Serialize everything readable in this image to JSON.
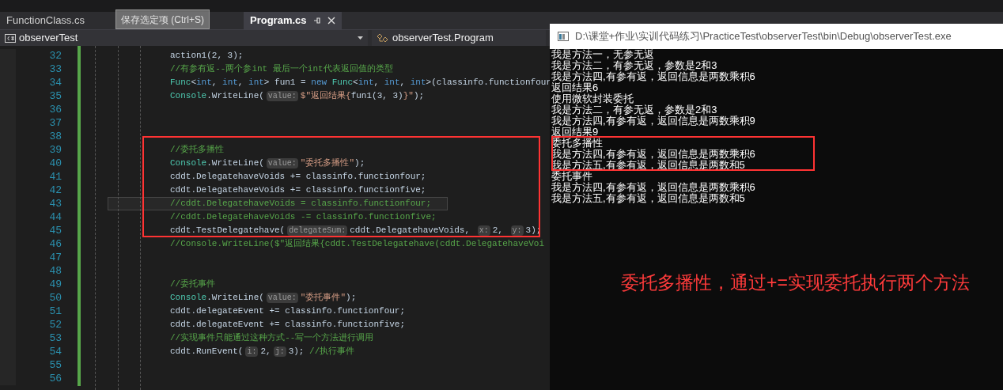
{
  "tabs": [
    {
      "label": "FunctionClass.cs",
      "selected": false
    },
    {
      "label": "Program.cs",
      "selected": true
    }
  ],
  "tooltip": "保存选定项 (Ctrl+S)",
  "navigation": {
    "project": "observerTest",
    "class": "observerTest.Program"
  },
  "code_lines": [
    {
      "number": "32",
      "current": false,
      "tokens": [
        {
          "kind": "code",
          "text": "action1(2, 3);"
        }
      ]
    },
    {
      "number": "33",
      "current": false,
      "tokens": [
        {
          "kind": "comment",
          "text": "//有参有返--两个参int 最后一个int代表返回值的类型"
        }
      ]
    },
    {
      "number": "34",
      "current": false,
      "tokens": [
        {
          "kind": "type",
          "text": "Func"
        },
        {
          "kind": "code",
          "text": "<"
        },
        {
          "kind": "keyword",
          "text": "int"
        },
        {
          "kind": "code",
          "text": ", "
        },
        {
          "kind": "keyword",
          "text": "int"
        },
        {
          "kind": "code",
          "text": ", "
        },
        {
          "kind": "keyword",
          "text": "int"
        },
        {
          "kind": "code",
          "text": "> fun1 = "
        },
        {
          "kind": "keyword",
          "text": "new"
        },
        {
          "kind": "type",
          "text": "Func",
          "spaced": true
        },
        {
          "kind": "code",
          "text": "<"
        },
        {
          "kind": "keyword",
          "text": "int"
        },
        {
          "kind": "code",
          "text": ", "
        },
        {
          "kind": "keyword",
          "text": "int"
        },
        {
          "kind": "code",
          "text": ", "
        },
        {
          "kind": "keyword",
          "text": "int"
        },
        {
          "kind": "code",
          "text": ">(classinfo.functionfour"
        }
      ]
    },
    {
      "number": "35",
      "current": false,
      "tokens": [
        {
          "kind": "type",
          "text": "Console"
        },
        {
          "kind": "code",
          "text": ".WriteLine("
        },
        {
          "kind": "hint",
          "text": "value:"
        },
        {
          "kind": "string",
          "text": "$\"返回结果{"
        },
        {
          "kind": "code",
          "text": "fun1(3, 3)"
        },
        {
          "kind": "string",
          "text": "}\""
        },
        {
          "kind": "code",
          "text": ");"
        }
      ]
    },
    {
      "number": "36",
      "current": false
    },
    {
      "number": "37",
      "current": false
    },
    {
      "number": "38",
      "current": false
    },
    {
      "number": "39",
      "current": false,
      "tokens": [
        {
          "kind": "comment",
          "text": "//委托多播性"
        }
      ]
    },
    {
      "number": "40",
      "current": false,
      "tokens": [
        {
          "kind": "type",
          "text": "Console"
        },
        {
          "kind": "code",
          "text": ".WriteLine("
        },
        {
          "kind": "hint",
          "text": "value:"
        },
        {
          "kind": "string",
          "text": "\"委托多播性\""
        },
        {
          "kind": "code",
          "text": ");"
        }
      ]
    },
    {
      "number": "41",
      "current": false,
      "tokens": [
        {
          "kind": "code",
          "text": "cddt.DelegatehaveVoids += classinfo.functionfour;"
        }
      ]
    },
    {
      "number": "42",
      "current": false,
      "tokens": [
        {
          "kind": "code",
          "text": "cddt.DelegatehaveVoids += classinfo.functionfive;"
        }
      ]
    },
    {
      "number": "43",
      "current": true,
      "tokens": [
        {
          "kind": "comment",
          "text": "//cddt.DelegatehaveVoids = classinfo.functionfour;"
        }
      ]
    },
    {
      "number": "44",
      "current": false,
      "tokens": [
        {
          "kind": "comment",
          "text": "//cddt.DelegatehaveVoids -= classinfo.functionfive;"
        }
      ]
    },
    {
      "number": "45",
      "current": false,
      "tokens": [
        {
          "kind": "code",
          "text": "cddt.TestDelegatehave("
        },
        {
          "kind": "hint",
          "text": "delegateSum:"
        },
        {
          "kind": "code",
          "text": "cddt.DelegatehaveVoids, "
        },
        {
          "kind": "hint",
          "text": "x:"
        },
        {
          "kind": "code",
          "text": "2, "
        },
        {
          "kind": "hint",
          "text": "y:"
        },
        {
          "kind": "code",
          "text": "3);"
        }
      ]
    },
    {
      "number": "46",
      "current": false,
      "tokens": [
        {
          "kind": "comment",
          "text": "//Console.WriteLine($\"返回结果{cddt.TestDelegatehave(cddt.DelegatehaveVoi"
        }
      ]
    },
    {
      "number": "47",
      "current": false
    },
    {
      "number": "48",
      "current": false
    },
    {
      "number": "49",
      "current": false,
      "tokens": [
        {
          "kind": "comment",
          "text": "//委托事件"
        }
      ]
    },
    {
      "number": "50",
      "current": false,
      "tokens": [
        {
          "kind": "type",
          "text": "Console"
        },
        {
          "kind": "code",
          "text": ".WriteLine("
        },
        {
          "kind": "hint",
          "text": "value:"
        },
        {
          "kind": "string",
          "text": "\"委托事件\""
        },
        {
          "kind": "code",
          "text": ");"
        }
      ]
    },
    {
      "number": "51",
      "current": false,
      "tokens": [
        {
          "kind": "code",
          "text": "cddt.delegateEvent += classinfo.functionfour;"
        }
      ]
    },
    {
      "number": "52",
      "current": false,
      "tokens": [
        {
          "kind": "code",
          "text": "cddt.delegateEvent += classinfo.functionfive;"
        }
      ]
    },
    {
      "number": "53",
      "current": false,
      "tokens": [
        {
          "kind": "comment",
          "text": "//实现事件只能通过这种方式--写一个方法进行调用"
        }
      ]
    },
    {
      "number": "54",
      "current": false,
      "tokens": [
        {
          "kind": "code",
          "text": "cddt.RunEvent("
        },
        {
          "kind": "hint",
          "text": "i:"
        },
        {
          "kind": "code",
          "text": "2,"
        },
        {
          "kind": "hint",
          "text": "j:"
        },
        {
          "kind": "code",
          "text": "3); "
        },
        {
          "kind": "comment",
          "text": "//执行事件"
        }
      ]
    },
    {
      "number": "55",
      "current": false
    },
    {
      "number": "56",
      "current": false
    }
  ],
  "console": {
    "title": "D:\\课堂+作业\\实训代码练习\\PracticeTest\\observerTest\\bin\\Debug\\observerTest.exe",
    "lines": [
      "我是方法一，无参无返",
      "我是方法二，有参无返，参数是2和3",
      "我是方法四,有参有返，返回信息是两数乘积6",
      "返回结果6",
      "使用微软封装委托",
      "我是方法二，有参无返，参数是2和3",
      "我是方法四,有参有返，返回信息是两数乘积9",
      "返回结果9",
      "委托多播性",
      "我是方法四,有参有返，返回信息是两数乘积6",
      "我是方法五,有参有返，返回信息是两数和5",
      "委托事件",
      "我是方法四,有参有返，返回信息是两数乘积6",
      "我是方法五,有参有返，返回信息是两数和5"
    ]
  },
  "annotation": "委托多播性，通过+=实现委托执行两个方法"
}
